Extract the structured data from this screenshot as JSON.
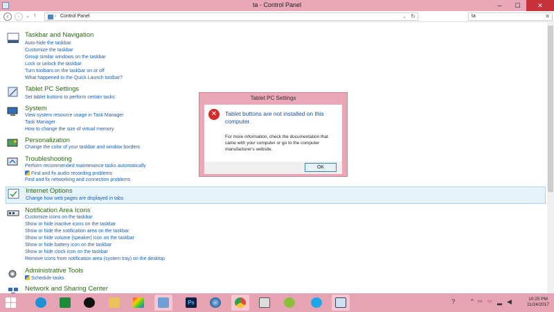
{
  "window": {
    "title": "ta - Control Panel",
    "minimize": "─",
    "maximize": "☐",
    "close": "✕"
  },
  "address": {
    "path": "Control Panel",
    "separator": "›",
    "search_value": "ta",
    "dropdown": "⌄",
    "refresh": "↻",
    "clear": "✕",
    "nav_dropdown": "⌄",
    "up": "↑"
  },
  "groups": {
    "taskbar": {
      "title": "Taskbar and Navigation",
      "links": [
        "Auto-hide the taskbar",
        "Customize the taskbar",
        "Group similar windows on the taskbar",
        "Lock or unlock the taskbar",
        "Turn toolbars on the taskbar on or off",
        "What happened to the Quick Launch toolbar?"
      ]
    },
    "tablet": {
      "title": "Tablet PC Settings",
      "links": [
        "Set tablet buttons to perform certain tasks"
      ]
    },
    "system": {
      "title": "System",
      "links": [
        "View system resource usage in Task Manager",
        "Task Manager",
        "How to change the size of virtual memory"
      ]
    },
    "personalization": {
      "title": "Personalization",
      "links": [
        "Change the color of your taskbar and window borders"
      ]
    },
    "troubleshooting": {
      "title": "Troubleshooting",
      "links": [
        "Perform recommended maintenance tasks automatically",
        "Find and fix audio recording problems",
        "Find and fix networking and connection problems"
      ]
    },
    "internet": {
      "title": "Internet Options",
      "links": [
        "Change how web pages are displayed in tabs"
      ]
    },
    "notification": {
      "title": "Notification Area Icons",
      "links": [
        "Customize icons on the taskbar",
        "Show or hide inactive icons on the taskbar",
        "Show or hide the notification area on the taskbar",
        "Show or hide volume (speaker) icon on the taskbar",
        "Show or hide battery icon on the taskbar",
        "Show or hide clock icon on the taskbar",
        "Remove icons from notification area (system tray) on the desktop"
      ]
    },
    "admin": {
      "title": "Administrative Tools",
      "links": [
        "Schedule tasks"
      ]
    },
    "network": {
      "title": "Network and Sharing Center"
    }
  },
  "dialog": {
    "title": "Tablet PC Settings",
    "error_glyph": "✕",
    "message": "Tablet buttons are not installed on this computer.",
    "detail": "For more information, check the documentation that came with your computer or go to the computer manufacturer's website.",
    "ok_label": "OK"
  },
  "taskbar": {
    "clock_time": "10:25 PM",
    "clock_date": "11/24/2017",
    "tray_glyphs": {
      "help": "?",
      "chevron": "⌃",
      "network": "▂",
      "volume": "◀",
      "keyboard": "▭",
      "notify": "▭"
    },
    "ps_label": "Ps",
    "colors": {
      "start": "#ffffff",
      "ie": "#1e90d8",
      "excel": "#1f8a3c",
      "ps": "#0b1f44",
      "chrome": "#dd4b3a",
      "skype": "#1ea7e8"
    }
  }
}
